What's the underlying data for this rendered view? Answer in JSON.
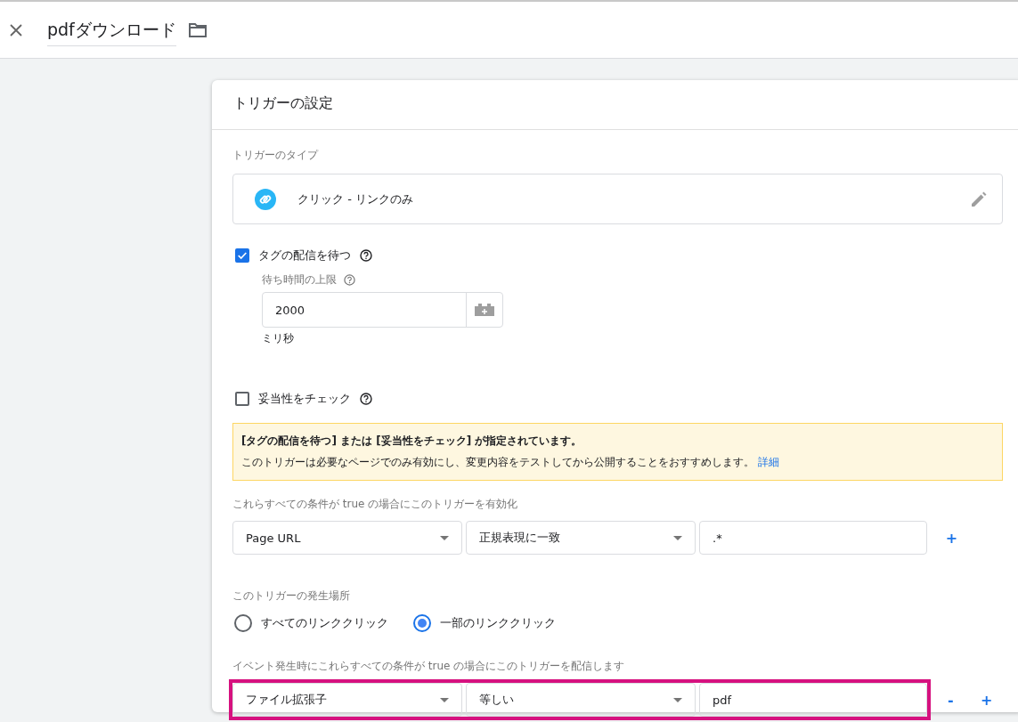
{
  "header": {
    "title": "pdfダウンロード"
  },
  "card": {
    "title": "トリガーの設定",
    "type_label": "トリガーのタイプ",
    "type_value": "クリック - リンクのみ",
    "wait_option": {
      "label": "タグの配信を待つ",
      "checked": true
    },
    "wait_limit": {
      "label": "待ち時間の上限",
      "value": "2000",
      "unit": "ミリ秒"
    },
    "validate_option": {
      "label": "妥当性をチェック",
      "checked": false
    },
    "notice": {
      "title": "[タグの配信を待つ] または [妥当性をチェック] が指定されています。",
      "body": "このトリガーは必要なページでのみ有効にし、変更内容をテストしてから公開することをおすすめします。",
      "link": "詳細"
    },
    "conditions_label": "これらすべての条件が true の場合にこのトリガーを有効化",
    "conditions": [
      {
        "variable": "Page URL",
        "operator": "正規表現に一致",
        "value": ".*",
        "removable": false,
        "highlighted": false
      }
    ],
    "fire_label": "このトリガーの発生場所",
    "fire_options": [
      {
        "label": "すべてのリンククリック",
        "selected": false
      },
      {
        "label": "一部のリンククリック",
        "selected": true
      }
    ],
    "filter_label": "イベント発生時にこれらすべての条件が true の場合にこのトリガーを配信します",
    "filters": [
      {
        "variable": "ファイル拡張子",
        "operator": "等しい",
        "value": "pdf",
        "removable": true,
        "highlighted": true
      }
    ],
    "remove_symbol": "-",
    "add_symbol": "+"
  }
}
